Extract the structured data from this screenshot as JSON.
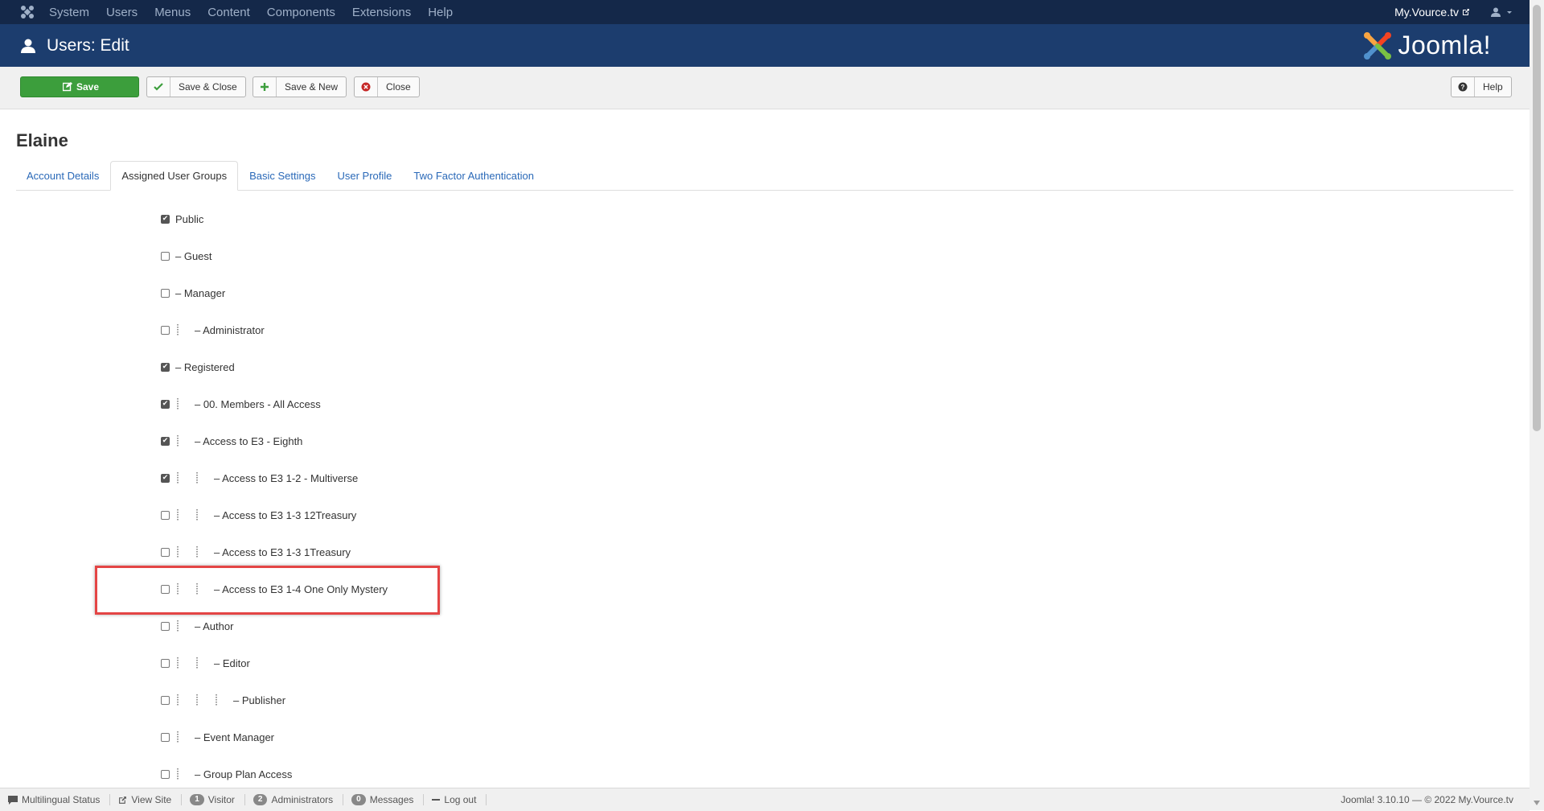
{
  "topnav": {
    "menu": [
      "System",
      "Users",
      "Menus",
      "Content",
      "Components",
      "Extensions",
      "Help"
    ],
    "site_name": "My.Vource.tv"
  },
  "header": {
    "title": "Users: Edit",
    "brand": "Joomla!"
  },
  "toolbar": {
    "save": "Save",
    "save_close": "Save & Close",
    "save_new": "Save & New",
    "close": "Close",
    "help": "Help"
  },
  "page": {
    "user_name": "Elaine",
    "tabs": [
      "Account Details",
      "Assigned User Groups",
      "Basic Settings",
      "User Profile",
      "Two Factor Authentication"
    ],
    "active_tab": "Assigned User Groups"
  },
  "groups": [
    {
      "label": "Public",
      "level": 0,
      "checked": true
    },
    {
      "label": "– Guest",
      "level": 0,
      "checked": false
    },
    {
      "label": "– Manager",
      "level": 0,
      "checked": false
    },
    {
      "label": "– Administrator",
      "level": 1,
      "checked": false
    },
    {
      "label": "– Registered",
      "level": 0,
      "checked": true
    },
    {
      "label": "– 00. Members - All Access",
      "level": 1,
      "checked": true
    },
    {
      "label": "– Access to E3 - Eighth",
      "level": 1,
      "checked": true
    },
    {
      "label": "– Access to E3 1-2 - Multiverse",
      "level": 2,
      "checked": true
    },
    {
      "label": "– Access to E3 1-3 12Treasury",
      "level": 2,
      "checked": false
    },
    {
      "label": "– Access to E3 1-3 1Treasury",
      "level": 2,
      "checked": false
    },
    {
      "label": "– Access to E3 1-4 One Only Mystery",
      "level": 2,
      "checked": false
    },
    {
      "label": "– Author",
      "level": 1,
      "checked": false
    },
    {
      "label": "– Editor",
      "level": 2,
      "checked": false
    },
    {
      "label": "– Publisher",
      "level": 3,
      "checked": false
    },
    {
      "label": "– Event Manager",
      "level": 1,
      "checked": false
    },
    {
      "label": "– Group Plan Access",
      "level": 1,
      "checked": false
    }
  ],
  "statusbar": {
    "multilingual": "Multilingual Status",
    "view_site": "View Site",
    "visitor_count": "1",
    "visitor_label": "Visitor",
    "admin_count": "2",
    "admin_label": "Administrators",
    "messages_count": "0",
    "messages_label": "Messages",
    "logout": "Log out",
    "footer": "Joomla! 3.10.10  —  © 2022 My.Vource.tv"
  }
}
